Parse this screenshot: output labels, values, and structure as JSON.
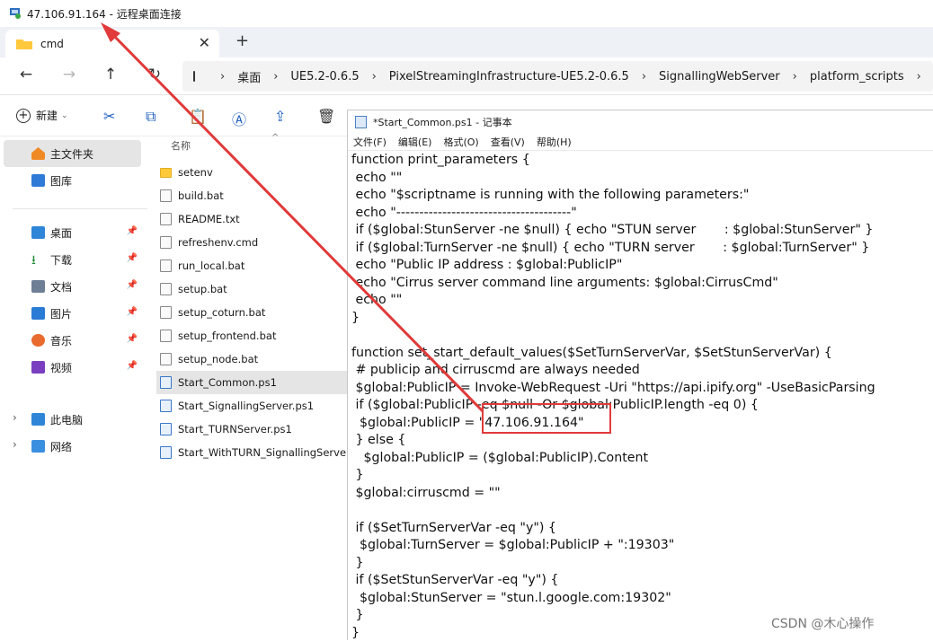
{
  "remote_window": {
    "title": "47.106.91.164 - 远程桌面连接"
  },
  "explorer": {
    "tab": {
      "label": "cmd"
    },
    "new_tab": "+",
    "breadcrumb": [
      "桌面",
      "UE5.2-0.6.5",
      "PixelStreamingInfrastructure-UE5.2-0.6.5",
      "SignallingWebServer",
      "platform_scripts"
    ],
    "toolbar": {
      "new_label": "新建"
    },
    "sidebar": {
      "home": "主文件夹",
      "gallery": "图库",
      "pinned": [
        {
          "label": "桌面",
          "icon": "desktop-icon"
        },
        {
          "label": "下载",
          "icon": "download-icon"
        },
        {
          "label": "文档",
          "icon": "document-icon"
        },
        {
          "label": "图片",
          "icon": "pictures-icon"
        },
        {
          "label": "音乐",
          "icon": "music-icon"
        },
        {
          "label": "视频",
          "icon": "video-icon"
        }
      ],
      "this_pc": "此电脑",
      "network": "网络"
    },
    "file_list": {
      "header_name": "名称",
      "files": [
        "setenv",
        "build.bat",
        "README.txt",
        "refreshenv.cmd",
        "run_local.bat",
        "setup.bat",
        "setup_coturn.bat",
        "setup_frontend.bat",
        "setup_node.bat",
        "Start_Common.ps1",
        "Start_SignallingServer.ps1",
        "Start_TURNServer.ps1",
        "Start_WithTURN_SignallingServer"
      ],
      "selected": "Start_Common.ps1"
    }
  },
  "notepad": {
    "title": "*Start_Common.ps1 - 记事本",
    "menu": [
      "文件(F)",
      "编辑(E)",
      "格式(O)",
      "查看(V)",
      "帮助(H)"
    ],
    "lines": [
      "function print_parameters {",
      " echo \"\"",
      " echo \"$scriptname is running with the following parameters:\"",
      " echo \"--------------------------------------\"",
      " if ($global:StunServer -ne $null) { echo \"STUN server       : $global:StunServer\" }",
      " if ($global:TurnServer -ne $null) { echo \"TURN server       : $global:TurnServer\" }",
      " echo \"Public IP address : $global:PublicIP\"",
      " echo \"Cirrus server command line arguments: $global:CirrusCmd\"",
      " echo \"\"",
      "}",
      "",
      "function set_start_default_values($SetTurnServerVar, $SetStunServerVar) {",
      " # publicip and cirruscmd are always needed",
      " $global:PublicIP = Invoke-WebRequest -Uri \"https://api.ipify.org\" -UseBasicParsing",
      " if ($global:PublicIP -eq $null -Or $global:PublicIP.length -eq 0) {",
      "  $global:PublicIP = \"47.106.91.164\"",
      " } else {",
      "   $global:PublicIP = ($global:PublicIP).Content",
      " }",
      " $global:cirruscmd = \"\"",
      "",
      " if ($SetTurnServerVar -eq \"y\") {",
      "  $global:TurnServer = $global:PublicIP + \":19303\"",
      " }",
      " if ($SetStunServerVar -eq \"y\") {",
      "  $global:StunServer = \"stun.l.google.com:19302\"",
      " }",
      "}"
    ]
  },
  "annotation": {
    "color": "#e03a3a"
  },
  "watermark": "CSDN @木心操作"
}
